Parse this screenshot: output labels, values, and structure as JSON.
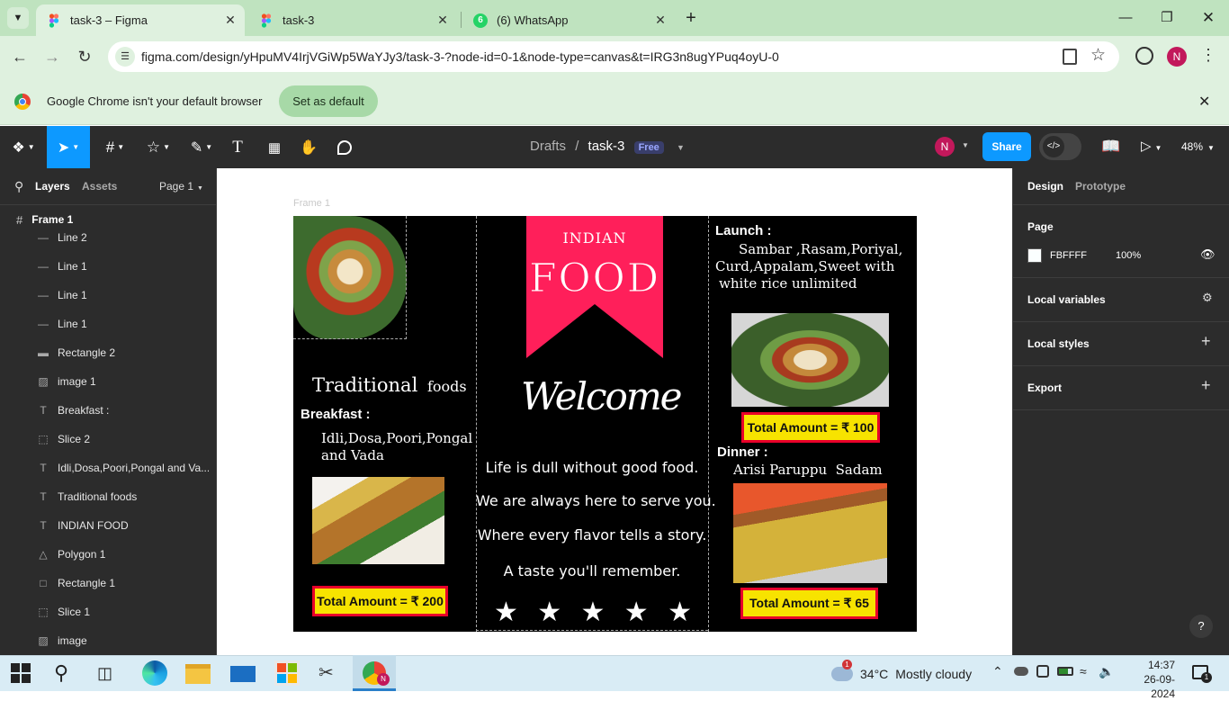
{
  "browser": {
    "tabs": [
      {
        "title": "task-3 – Figma",
        "active": true
      },
      {
        "title": "task-3",
        "active": false
      },
      {
        "title": "(6) WhatsApp",
        "active": false
      }
    ],
    "whatsapp_badge": "6",
    "url": "figma.com/design/yHpuMV4IrjVGiWp5WaYJy3/task-3-?node-id=0-1&node-type=canvas&t=IRG3n8ugYPuq4oyU-0",
    "profile_initial": "N",
    "infobar_message": "Google Chrome isn't your default browser",
    "infobar_button": "Set as default"
  },
  "figma": {
    "breadcrumb_drafts": "Drafts",
    "breadcrumb_sep": "/",
    "file_name": "task-3",
    "plan_badge": "Free",
    "user_initial": "N",
    "share_label": "Share",
    "zoom": "48%",
    "left_panel": {
      "tab_layers": "Layers",
      "tab_assets": "Assets",
      "page_selector": "Page 1",
      "frame_name": "Frame 1",
      "layers": [
        {
          "icon": "line-icon",
          "name": "Line 2"
        },
        {
          "icon": "line-icon",
          "name": "Line 1"
        },
        {
          "icon": "line-icon",
          "name": "Line 1"
        },
        {
          "icon": "line-icon",
          "name": "Line 1"
        },
        {
          "icon": "rectangle-icon",
          "name": "Rectangle 2"
        },
        {
          "icon": "image-icon",
          "name": "image 1"
        },
        {
          "icon": "text-icon",
          "name": "Breakfast :"
        },
        {
          "icon": "slice-icon",
          "name": "Slice 2"
        },
        {
          "icon": "text-icon",
          "name": "Idli,Dosa,Poori,Pongal and Va..."
        },
        {
          "icon": "text-icon",
          "name": "Traditional foods"
        },
        {
          "icon": "text-icon",
          "name": "INDIAN FOOD"
        },
        {
          "icon": "polygon-icon",
          "name": "Polygon 1"
        },
        {
          "icon": "rectangle-icon",
          "name": "Rectangle 1"
        },
        {
          "icon": "slice-icon",
          "name": "Slice 1"
        },
        {
          "icon": "image-icon",
          "name": "image"
        }
      ]
    },
    "right_panel": {
      "tab_design": "Design",
      "tab_prototype": "Prototype",
      "page_label": "Page",
      "page_color": "FBFFFF",
      "page_opacity": "100%",
      "local_variables": "Local variables",
      "local_styles": "Local styles",
      "export": "Export"
    },
    "canvas": {
      "frame_label": "Frame 1",
      "indian": "INDIAN",
      "food": "FOOD",
      "welcome": "Welcome",
      "traditional": "Traditional",
      "foods": "foods",
      "breakfast_heading": "Breakfast :",
      "breakfast_items_line1": "Idli,Dosa,Poori,Pongal",
      "breakfast_items_line2": "and Vada",
      "breakfast_total": "Total Amount = ₹ 200",
      "launch_heading": "Launch :",
      "launch_line1": "Sambar ,Rasam,Poriyal,",
      "launch_line2": "Curd,Appalam,Sweet with",
      "launch_line3": "white rice unlimited",
      "launch_total": "Total Amount = ₹ 100",
      "dinner_heading": "Dinner :",
      "dinner_items": "Arisi Paruppu  Sadam",
      "dinner_total": "Total Amount = ₹ 65",
      "taglines": [
        "Life is dull without good food.",
        "We are always here to serve you.",
        "Where every flavor tells a story.",
        "A taste you'll remember."
      ],
      "stars": 5,
      "ribbon_color": "#ff1f5a"
    }
  },
  "taskbar": {
    "weather_temp": "34°C",
    "weather_desc": "Mostly cloudy",
    "weather_badge": "1",
    "time": "14:37",
    "date": "26-09-2024",
    "notification_count": "1"
  }
}
